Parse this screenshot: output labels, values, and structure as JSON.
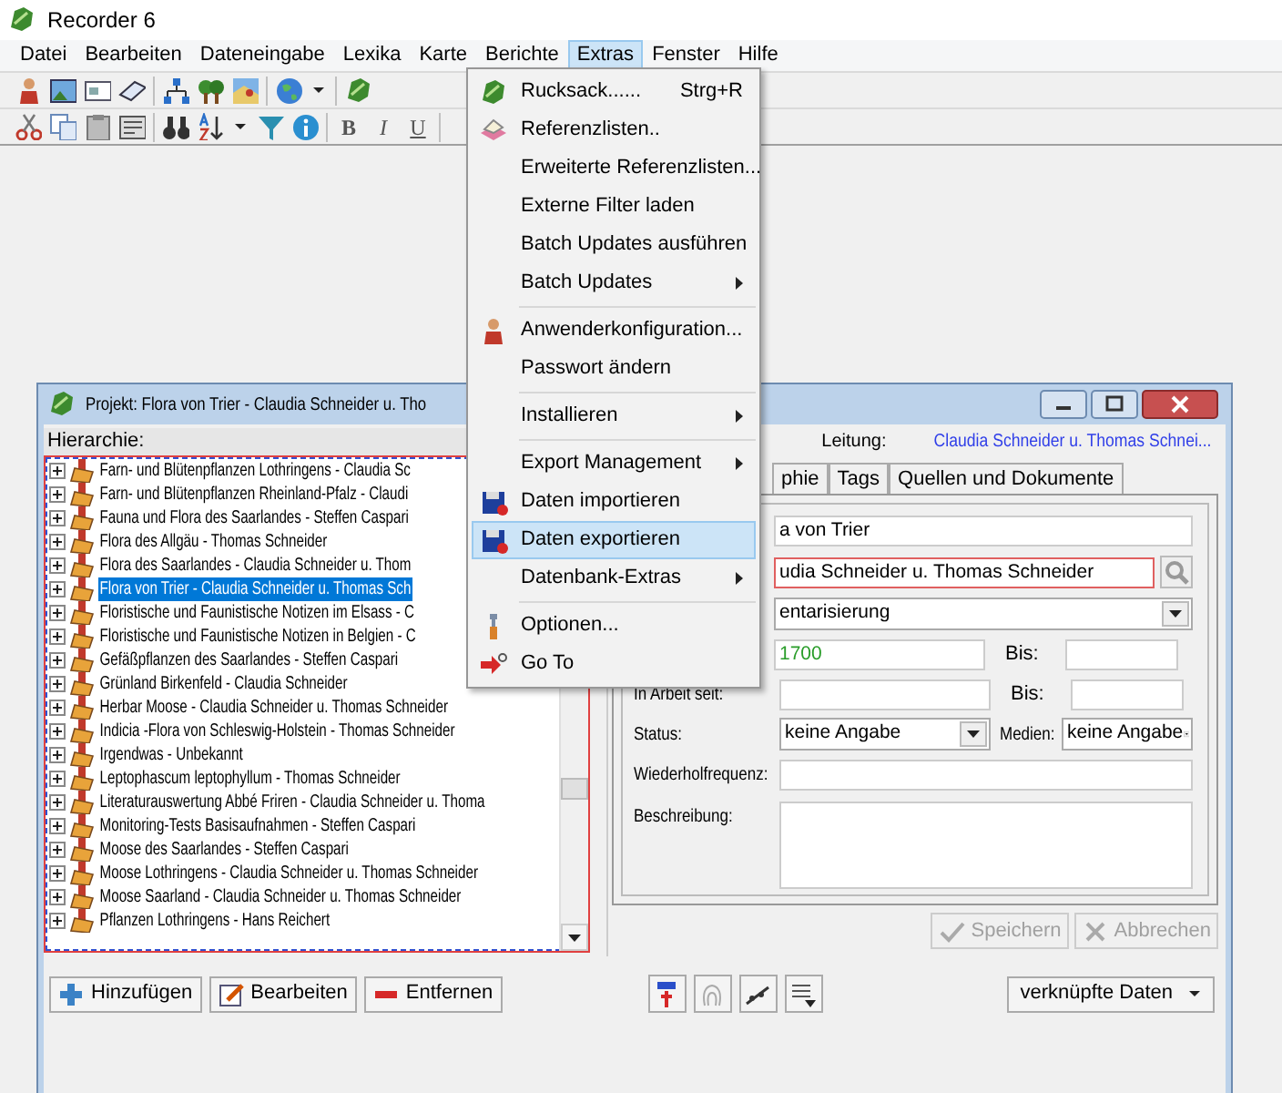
{
  "window": {
    "title": "Recorder 6"
  },
  "menu_bar": [
    {
      "label": "Datei",
      "selected": false
    },
    {
      "label": "Bearbeiten",
      "selected": false
    },
    {
      "label": "Dateneingabe",
      "selected": false
    },
    {
      "label": "Lexika",
      "selected": false
    },
    {
      "label": "Karte",
      "selected": false
    },
    {
      "label": "Berichte",
      "selected": false
    },
    {
      "label": "Extras",
      "selected": true
    },
    {
      "label": "Fenster",
      "selected": false
    },
    {
      "label": "Hilfe",
      "selected": false
    }
  ],
  "toolbar": {
    "format_buttons": [
      "B",
      "I",
      "U"
    ]
  },
  "extras_menu": [
    {
      "kind": "item",
      "label": "Rucksack......",
      "shortcut": "Strg+R",
      "submenu": false,
      "selected": false
    },
    {
      "kind": "item",
      "label": "Referenzlisten..",
      "submenu": false,
      "selected": false
    },
    {
      "kind": "item",
      "label": "Erweiterte Referenzlisten...",
      "submenu": false,
      "selected": false
    },
    {
      "kind": "item",
      "label": "Externe Filter laden",
      "submenu": false,
      "selected": false
    },
    {
      "kind": "item",
      "label": "Batch Updates ausführen",
      "submenu": false,
      "selected": false
    },
    {
      "kind": "item",
      "label": "Batch Updates",
      "submenu": true,
      "selected": false
    },
    {
      "kind": "separator"
    },
    {
      "kind": "item",
      "label": "Anwenderkonfiguration...",
      "submenu": false,
      "selected": false
    },
    {
      "kind": "item",
      "label": "Passwort ändern",
      "submenu": false,
      "selected": false
    },
    {
      "kind": "separator"
    },
    {
      "kind": "item",
      "label": "Installieren",
      "submenu": true,
      "selected": false
    },
    {
      "kind": "separator"
    },
    {
      "kind": "item",
      "label": "Export Management",
      "submenu": true,
      "selected": false
    },
    {
      "kind": "item",
      "label": "Daten importieren",
      "submenu": false,
      "selected": false
    },
    {
      "kind": "item",
      "label": "Daten exportieren",
      "submenu": false,
      "selected": true
    },
    {
      "kind": "item",
      "label": "Datenbank-Extras",
      "submenu": true,
      "selected": false
    },
    {
      "kind": "separator"
    },
    {
      "kind": "item",
      "label": "Optionen...",
      "submenu": false,
      "selected": false
    },
    {
      "kind": "item",
      "label": "Go To",
      "submenu": false,
      "selected": false
    }
  ],
  "project_window": {
    "title": "Projekt: Flora von Trier - Claudia Schneider u. Tho",
    "hierarchy_label": "Hierarchie:",
    "projects": [
      {
        "label": "Farn- und Blütenpflanzen Lothringens - Claudia Sc",
        "selected": false
      },
      {
        "label": "Farn- und Blütenpflanzen Rheinland-Pfalz - Claudi",
        "selected": false
      },
      {
        "label": "Fauna und Flora des Saarlandes - Steffen Caspari",
        "selected": false
      },
      {
        "label": "Flora des Allgäu - Thomas Schneider",
        "selected": false
      },
      {
        "label": "Flora des Saarlandes - Claudia Schneider u. Thom",
        "selected": false
      },
      {
        "label": "Flora von Trier - Claudia Schneider u. Thomas Sch",
        "selected": true
      },
      {
        "label": "Floristische und Faunistische Notizen im Elsass - C",
        "selected": false
      },
      {
        "label": "Floristische und Faunistische Notizen in Belgien - C",
        "selected": false
      },
      {
        "label": "Gefäßpflanzen des Saarlandes - Steffen Caspari",
        "selected": false
      },
      {
        "label": "Grünland Birkenfeld - Claudia Schneider",
        "selected": false
      },
      {
        "label": "Herbar Moose - Claudia Schneider u. Thomas Schneider",
        "selected": false
      },
      {
        "label": "Indicia -Flora von Schleswig-Holstein - Thomas Schneider",
        "selected": false
      },
      {
        "label": "Irgendwas - Unbekannt",
        "selected": false
      },
      {
        "label": "Leptophascum leptophyllum - Thomas Schneider",
        "selected": false
      },
      {
        "label": "Literaturauswertung Abbé Friren - Claudia Schneider u. Thoma",
        "selected": false
      },
      {
        "label": "Monitoring-Tests Basisaufnahmen - Steffen Caspari",
        "selected": false
      },
      {
        "label": "Moose des Saarlandes - Steffen Caspari",
        "selected": false
      },
      {
        "label": "Moose Lothringens - Claudia Schneider u. Thomas Schneider",
        "selected": false
      },
      {
        "label": "Moose Saarland - Claudia Schneider u. Thomas Schneider",
        "selected": false
      },
      {
        "label": "Pflanzen Lothringens - Hans Reichert",
        "selected": false
      }
    ],
    "leitung_label": "Leitung:",
    "leitung_link": "Claudia Schneider u. Thomas Schnei...",
    "tabs": [
      {
        "label": "phie",
        "selected": false
      },
      {
        "label": "Tags",
        "selected": false
      },
      {
        "label": "Quellen und Dokumente",
        "selected": false
      }
    ],
    "name_value": "a von Trier",
    "leader_value": "udia Schneider u. Thomas Schneider",
    "type_value": "entarisierung",
    "from_value": "1700",
    "bis_label": "Bis:",
    "in_arbeit_label": "In Arbeit seit:",
    "bis_label_2": "Bis:",
    "status_label": "Status:",
    "status_value": "keine Angabe",
    "medien_label": "Medien:",
    "medien_value": "keine Angabe",
    "wiederhol_label": "Wiederholfrequenz:",
    "beschreibung_label": "Beschreibung:",
    "save_button": {
      "label": "Speichern",
      "disabled": true
    },
    "cancel_button": {
      "label": "Abbrechen",
      "disabled": true
    },
    "bottom_buttons": [
      "Hinzufügen",
      "Bearbeiten",
      "Entfernen"
    ],
    "linked_data_button": "verknüpfte Daten"
  }
}
